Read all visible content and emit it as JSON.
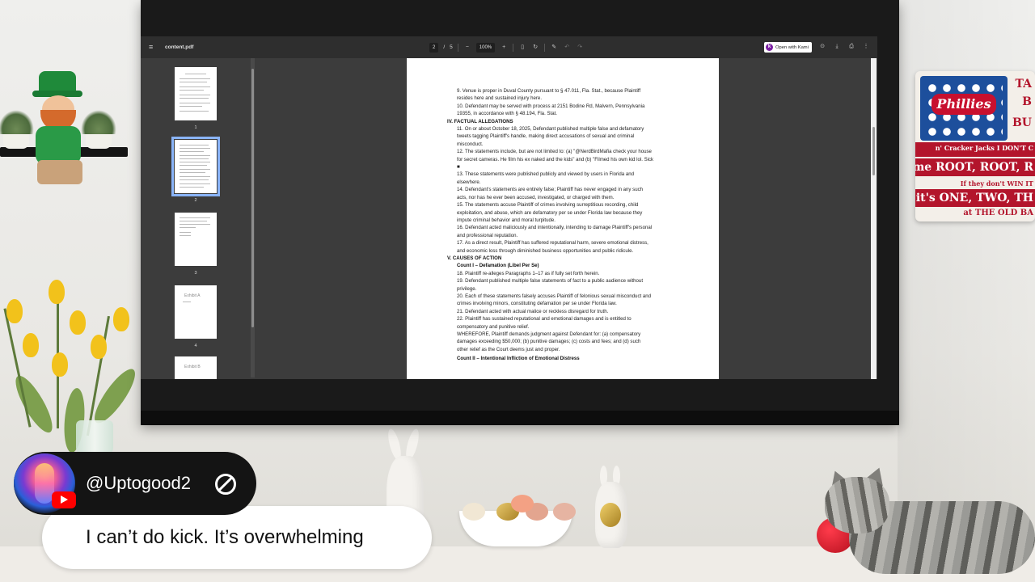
{
  "viewer": {
    "title": "content.pdf",
    "page_current": "2",
    "page_separator": "/",
    "page_total": "5",
    "zoom": "100%",
    "open_with_label": "Open with Kami",
    "icons": [
      "menu-icon",
      "zoom-out-icon",
      "zoom-in-icon",
      "fit-page-icon",
      "rotate-icon",
      "draw-icon",
      "undo-icon",
      "redo-icon",
      "kami-icon",
      "annotate-icon",
      "download-icon",
      "print-icon",
      "more-icon"
    ]
  },
  "thumbnails": [
    {
      "label": "1",
      "exhibit": ""
    },
    {
      "label": "2",
      "exhibit": ""
    },
    {
      "label": "3",
      "exhibit": ""
    },
    {
      "label": "4",
      "exhibit": "Exhibit A"
    },
    {
      "label": "",
      "exhibit": "Exhibit B"
    }
  ],
  "document": {
    "lines": [
      "9. Venue is proper in Duval County pursuant to § 47.011, Fla. Stat., because Plaintiff",
      "resides here and sustained injury here.",
      "10. Defendant may be served with process at 2151 Bodine Rd, Malvern, Pennsylvania",
      "19355, in accordance with § 48.194, Fla. Stat.",
      "IV. FACTUAL ALLEGATIONS",
      "11. On or about October 18, 2025, Defendant published multiple false and defamatory",
      "tweets tagging Plaintiff's handle, making direct accusations of sexual and criminal",
      "misconduct.",
      "12. The statements include, but are not limited to: (a) \"@NerdBirdMafia check your house",
      "for secret cameras. He film his ex naked and the kids\" and (b) \"Filmed his own kid lol. Sick",
      "■",
      "13. These statements were published publicly and viewed by users in Florida and",
      "elsewhere.",
      "14. Defendant's statements are entirely false; Plaintiff has never engaged in any such",
      "acts, nor has he ever been accused, investigated, or charged with them.",
      "15. The statements accuse Plaintiff of crimes involving surreptitious recording, child",
      "exploitation, and abuse, which are defamatory per se under Florida law because they",
      "impute criminal behavior and moral turpitude.",
      "16. Defendant acted maliciously and intentionally, intending to damage Plaintiff's personal",
      "and professional reputation.",
      "17. As a direct result, Plaintiff has suffered reputational harm, severe emotional distress,",
      "and economic loss through diminished business opportunities and public ridicule.",
      "V. CAUSES OF ACTION",
      "Count I – Defamation (Libel Per Se)",
      "18. Plaintiff re-alleges Paragraphs 1–17 as if fully set forth herein.",
      "19. Defendant published multiple false statements of fact to a public audience without",
      "privilege.",
      "20. Each of these statements falsely accuses Plaintiff of felonious sexual misconduct and",
      "crimes involving minors, constituting defamation per se under Florida law.",
      "21. Defendant acted with actual malice or reckless disregard for truth.",
      "22. Plaintiff has sustained reputational and emotional damages and is entitled to",
      "compensatory and punitive relief.",
      "WHEREFORE, Plaintiff demands judgment against Defendant for: (a) compensatory",
      "damages exceeding $50,000; (b) punitive damages; (c) costs and fees; and (d) such",
      "other relief as the Court deems just and proper.",
      "Count II – Intentional Infliction of Emotional Distress"
    ]
  },
  "decor": {
    "flag_logo": "Phillies",
    "flag_lines": [
      "TA",
      "B",
      "BU",
      "n' Cracker Jacks I DON'T C",
      "Let me ROOT, ROOT, R",
      "If they don't WIN IT",
      "For it's ONE, TWO, TH",
      "at THE OLD BA"
    ]
  },
  "chat": {
    "username": "@Uptogood2",
    "message": "I can’t do kick. It’s overwhelming"
  }
}
